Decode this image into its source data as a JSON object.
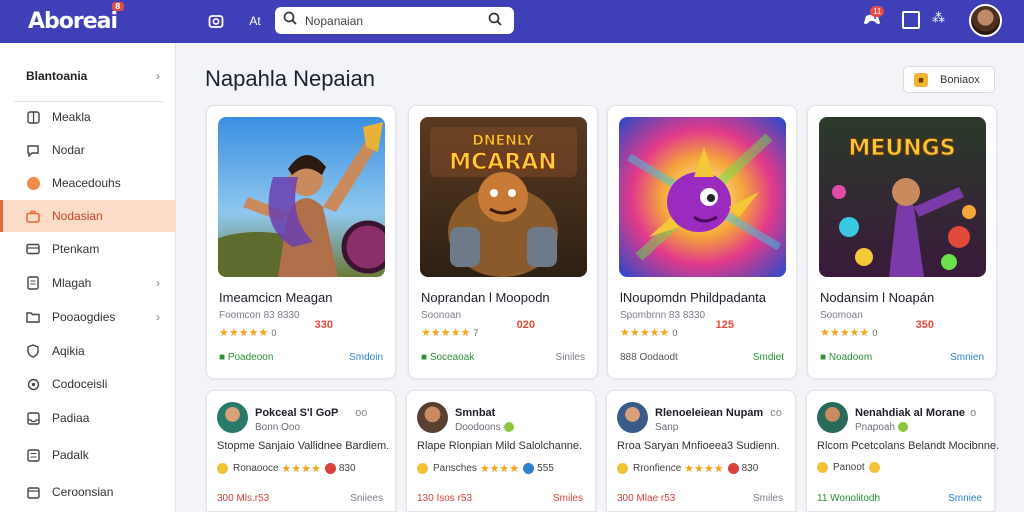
{
  "app": {
    "logo": "Aboreai",
    "logo_badge": "8"
  },
  "topbar": {
    "at_label": "At",
    "search_placeholder": "Nopanaian",
    "notifications_count": "11"
  },
  "sidebar": {
    "header": "Blantoania",
    "items": [
      {
        "label": "Meakla",
        "icon": "grid-icon",
        "chevron": false,
        "active": false
      },
      {
        "label": "Nodar",
        "icon": "chat-icon",
        "chevron": false,
        "active": false
      },
      {
        "label": "Meacedouhs",
        "icon": "orange-dot-icon",
        "chevron": false,
        "active": false
      },
      {
        "label": "Nodasian",
        "icon": "briefcase-icon",
        "chevron": false,
        "active": true
      },
      {
        "label": "Ptenkam",
        "icon": "card-icon",
        "chevron": false,
        "active": false
      },
      {
        "label": "Mlagah",
        "icon": "document-icon",
        "chevron": true,
        "active": false
      },
      {
        "label": "Pooaogdies",
        "icon": "folder-icon",
        "chevron": true,
        "active": false
      },
      {
        "label": "Aqikia",
        "icon": "shield-icon",
        "chevron": false,
        "active": false
      },
      {
        "label": "Codoceisli",
        "icon": "pin-icon",
        "chevron": false,
        "active": false
      },
      {
        "label": "Padiaa",
        "icon": "inbox-icon",
        "chevron": false,
        "active": false
      },
      {
        "label": "Padalk",
        "icon": "list-icon",
        "chevron": false,
        "active": false
      },
      {
        "label": "Ceroonsian",
        "icon": "calendar-icon",
        "chevron": false,
        "active": false
      }
    ]
  },
  "main": {
    "title": "Napahla Nepaian",
    "top_button": "Boniaox"
  },
  "games": [
    {
      "title": "Imeamcicn Meagan",
      "subtitle": "Foomcon 83 8330",
      "stars": "★★★★★",
      "count": "0",
      "price": "330",
      "foot_left": "Poadeoon",
      "foot_right": "Smdoin",
      "art_text": ""
    },
    {
      "title": "Noprandan l Moopodn",
      "subtitle": "Soonoan",
      "stars": "★★★★★",
      "count": "7",
      "price": "020",
      "foot_left": "Soceaoak",
      "foot_right": "Siniles",
      "art_text": "DNENLY MCARAN"
    },
    {
      "title": "lNoupomdn Phildpadanta",
      "subtitle": "Spombrnn 83 8330",
      "stars": "★★★★★",
      "count": "0",
      "price": "125",
      "foot_left": "888 Oodaodt",
      "foot_right": "Smdiet",
      "art_text": ""
    },
    {
      "title": "Nodansim l Noapán",
      "subtitle": "Soomoan",
      "stars": "★★★★★",
      "count": "0",
      "price": "350",
      "foot_left": "Noadoom",
      "foot_right": "Smnien",
      "art_text": "MEUNGS"
    }
  ],
  "reviews": [
    {
      "name": "Pokceal S'l GoP",
      "extra": "oo",
      "meta": "Bonn Ooo",
      "text": "Stopme Sanjaio Vallidnee Bardiem.",
      "row_label": "Ronaooce",
      "row_stars": "★★★★",
      "row_tail": "830",
      "foot_left": "300 Mls.r53",
      "foot_right": "Sniiees"
    },
    {
      "name": "Smnbat",
      "extra": "",
      "meta": "Doodoons",
      "text": "Rlape Rlonpian Mild Salolchanne.",
      "row_label": "Pansches",
      "row_stars": "★★★★",
      "row_tail": "555",
      "foot_left": "130 Isos r53",
      "foot_right": "Smiles"
    },
    {
      "name": "Rlenoeleiean Nupam",
      "extra": "co",
      "meta": "Sanp",
      "text": "Rroa Saryan Mnfioeea3 Sudienn.",
      "row_label": "Rronfience",
      "row_stars": "★★★★",
      "row_tail": "830",
      "foot_left": "300 Mlae r53",
      "foot_right": "Smiles"
    },
    {
      "name": "Nenahdiak al Morane",
      "extra": "o",
      "meta": "Pnapoah",
      "text": "Rlcom Pcetcolans Belandt Mocibnne.",
      "row_label": "Panoot",
      "row_stars": "",
      "row_tail": "",
      "foot_left": "11 Wonolitodh",
      "foot_right": "Smniee"
    }
  ],
  "colors": {
    "topbar": "#3f3fb8",
    "accent": "#e8683a",
    "active_bg": "#fbdcc8",
    "price": "#e44b3a",
    "star": "#f3a51b"
  }
}
